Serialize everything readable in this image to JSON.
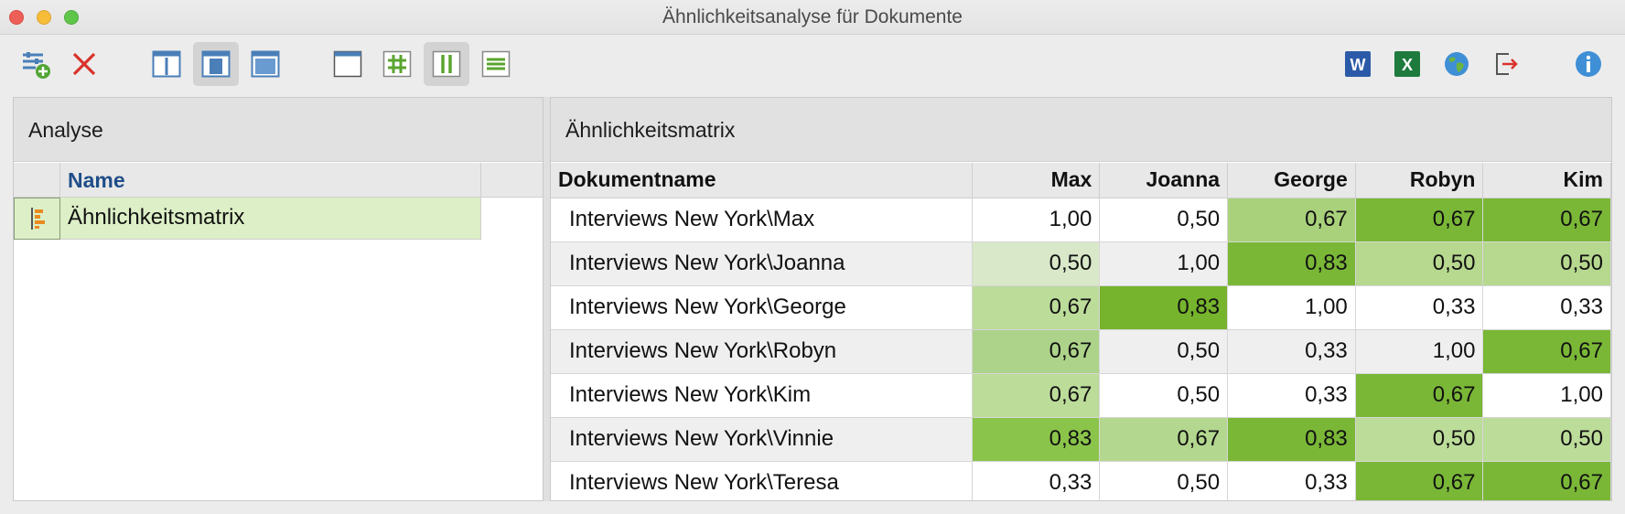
{
  "window": {
    "title": "Ähnlichkeitsanalyse für Dokumente"
  },
  "toolbar": {
    "buttons": [
      {
        "name": "new-analysis-icon",
        "pressed": false
      },
      {
        "name": "delete-icon",
        "pressed": false
      },
      {
        "name": "layout-left-icon",
        "pressed": false
      },
      {
        "name": "layout-center-icon",
        "pressed": true
      },
      {
        "name": "layout-full-icon",
        "pressed": false
      },
      {
        "name": "window-icon",
        "pressed": false
      },
      {
        "name": "hash-icon",
        "pressed": false
      },
      {
        "name": "columns-icon",
        "pressed": true
      },
      {
        "name": "rows-icon",
        "pressed": false
      },
      {
        "name": "word-export-icon",
        "label": "W",
        "pressed": false
      },
      {
        "name": "excel-export-icon",
        "label": "X",
        "pressed": false
      },
      {
        "name": "globe-icon",
        "pressed": false
      },
      {
        "name": "export-icon",
        "pressed": false
      },
      {
        "name": "info-icon",
        "pressed": false
      }
    ]
  },
  "left_pane": {
    "title": "Analyse",
    "column_header": "Name",
    "items": [
      {
        "label": "Ähnlichkeitsmatrix",
        "icon": "matrix-icon"
      }
    ]
  },
  "right_pane": {
    "title": "Ähnlichkeitsmatrix",
    "row_header": "Dokumentname",
    "columns": [
      "Max",
      "Joanna",
      "George",
      "Robyn",
      "Kim"
    ],
    "rows": [
      {
        "name": "Interviews New York\\Max",
        "values": [
          "1,00",
          "0,50",
          "0,67",
          "0,67",
          "0,67"
        ],
        "colors": [
          "#ffffff",
          "#ffffff",
          "#a9d17b",
          "#7ab737",
          "#7ab737"
        ]
      },
      {
        "name": "Interviews New York\\Joanna",
        "values": [
          "0,50",
          "1,00",
          "0,83",
          "0,50",
          "0,50"
        ],
        "colors": [
          "#d9e8c8",
          "#efefef",
          "#7ab737",
          "#b6d88f",
          "#b6d88f"
        ]
      },
      {
        "name": "Interviews New York\\George",
        "values": [
          "0,67",
          "0,83",
          "1,00",
          "0,33",
          "0,33"
        ],
        "colors": [
          "#bcdc9a",
          "#76b42d",
          "#ffffff",
          "#ffffff",
          "#ffffff"
        ]
      },
      {
        "name": "Interviews New York\\Robyn",
        "values": [
          "0,67",
          "0,50",
          "0,33",
          "1,00",
          "0,67"
        ],
        "colors": [
          "#add38a",
          "#efefef",
          "#efefef",
          "#efefef",
          "#7ab737"
        ]
      },
      {
        "name": "Interviews New York\\Kim",
        "values": [
          "0,67",
          "0,50",
          "0,33",
          "0,67",
          "1,00"
        ],
        "colors": [
          "#bcdc9a",
          "#ffffff",
          "#ffffff",
          "#7ab737",
          "#ffffff"
        ]
      },
      {
        "name": "Interviews New York\\Vinnie",
        "values": [
          "0,83",
          "0,67",
          "0,83",
          "0,50",
          "0,50"
        ],
        "colors": [
          "#8ac44a",
          "#b3d78e",
          "#7ab737",
          "#bcdc9a",
          "#bcdc9a"
        ]
      },
      {
        "name": "Interviews New York\\Teresa",
        "values": [
          "0,33",
          "0,50",
          "0,33",
          "0,67",
          "0,67"
        ],
        "colors": [
          "#ffffff",
          "#ffffff",
          "#ffffff",
          "#7ab737",
          "#7ab737"
        ]
      }
    ]
  }
}
